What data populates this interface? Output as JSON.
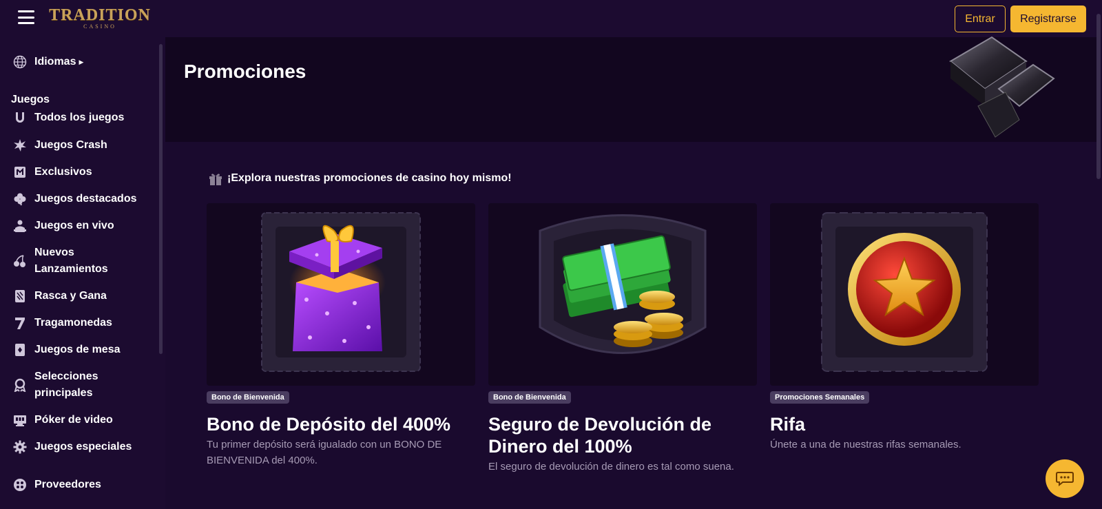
{
  "header": {
    "logo_text": "TRADITION",
    "logo_sub": "CASINO",
    "login_label": "Entrar",
    "register_label": "Registrarse"
  },
  "sidebar": {
    "languages_label": "Idiomas",
    "games_heading": "Juegos",
    "items": [
      {
        "label": "Todos los juegos",
        "icon": "horseshoe-icon"
      },
      {
        "label": "Juegos Crash",
        "icon": "explosion-icon"
      },
      {
        "label": "Exclusivos",
        "icon": "exclusive-icon"
      },
      {
        "label": "Juegos destacados",
        "icon": "clover-icon"
      },
      {
        "label": "Juegos en vivo",
        "icon": "live-dealer-icon"
      },
      {
        "label": "Nuevos Lanzamientos",
        "icon": "cherries-icon"
      },
      {
        "label": "Rasca y Gana",
        "icon": "scratch-card-icon"
      },
      {
        "label": "Tragamonedas",
        "icon": "seven-icon"
      },
      {
        "label": "Juegos de mesa",
        "icon": "playing-card-icon"
      },
      {
        "label": "Selecciones principales",
        "icon": "award-icon"
      },
      {
        "label": "Póker de video",
        "icon": "video-poker-icon"
      },
      {
        "label": "Juegos especiales",
        "icon": "gear-icon"
      }
    ],
    "providers_label": "Proveedores"
  },
  "main": {
    "page_title": "Promociones",
    "explore_text": "¡Explora nuestras promociones de casino hoy mismo!",
    "cards": [
      {
        "tag": "Bono de Bienvenida",
        "title": "Bono de Depósito del 400%",
        "description": "Tu primer depósito será igualado con un BONO DE BIENVENIDA del 400%."
      },
      {
        "tag": "Bono de Bienvenida",
        "title": "Seguro de Devolución de Dinero del 100%",
        "description": "El seguro de devolución de dinero es tal como suena."
      },
      {
        "tag": "Promociones Semanales",
        "title": "Rifa",
        "description": "Únete a una de nuestras rifas semanales."
      }
    ]
  },
  "colors": {
    "accent": "#f5b731",
    "background": "#1a0a2e",
    "tag_bg": "#4a3d60"
  }
}
